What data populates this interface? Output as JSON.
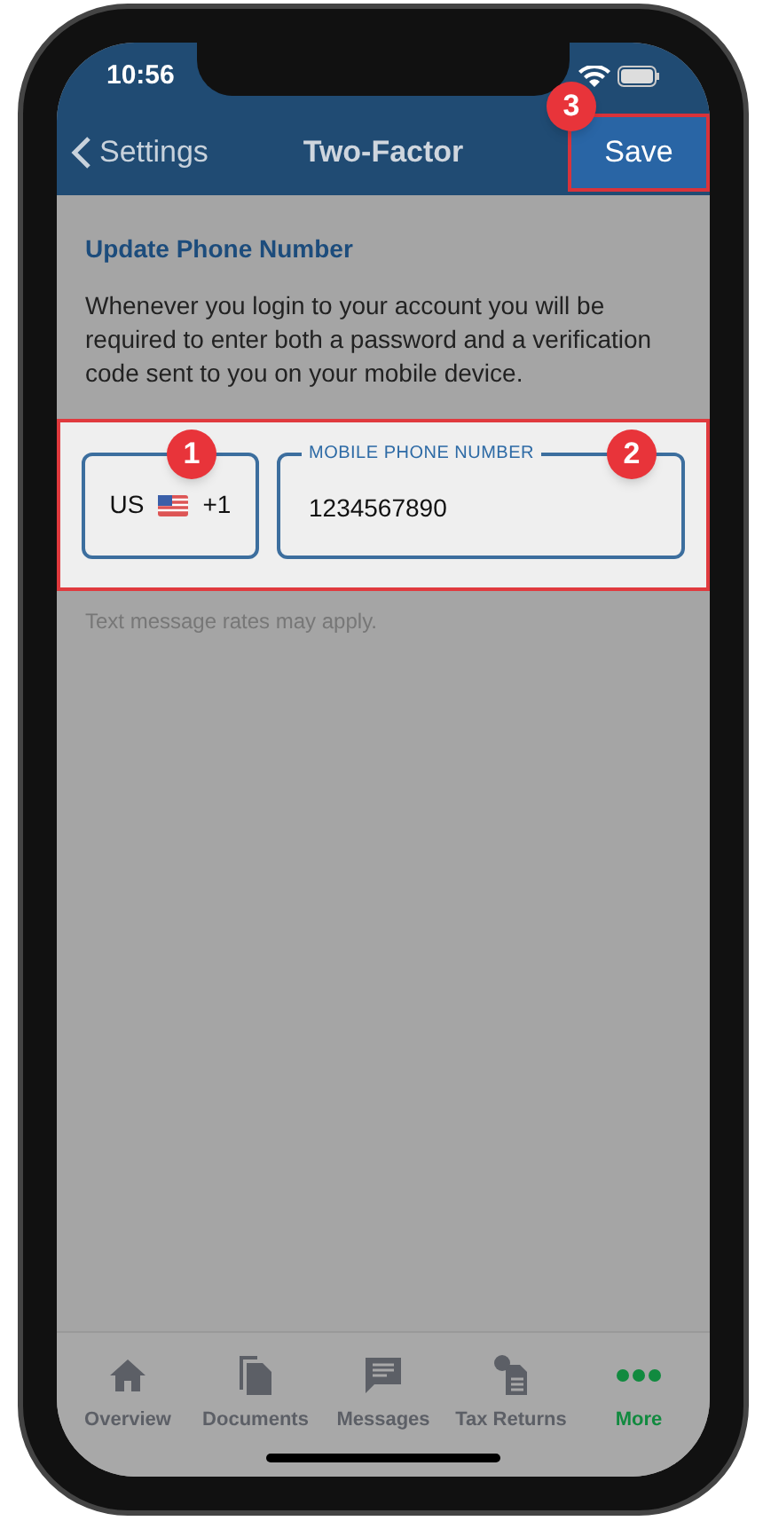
{
  "status_bar": {
    "time": "10:56"
  },
  "nav": {
    "back_label": "Settings",
    "title": "Two-Factor",
    "action": {
      "label": "Save",
      "badge": "3"
    }
  },
  "section": {
    "title": "Update Phone Number",
    "description": "Whenever you login to your account you will be required to enter both a password and a verification code sent to you on your mobile device."
  },
  "country_selector": {
    "code": "US",
    "dial_code": "+1",
    "badge": "1"
  },
  "phone_field": {
    "label": "MOBILE PHONE NUMBER",
    "value": "1234567890",
    "badge": "2"
  },
  "hint": "Text message rates may apply.",
  "tabs": [
    {
      "label": "Overview",
      "kind": "home",
      "selected": false
    },
    {
      "label": "Documents",
      "kind": "documents",
      "selected": false
    },
    {
      "label": "Messages",
      "kind": "messages",
      "selected": false
    },
    {
      "label": "Tax Returns",
      "kind": "tax",
      "selected": false
    },
    {
      "label": "More",
      "kind": "more",
      "selected": true
    }
  ]
}
